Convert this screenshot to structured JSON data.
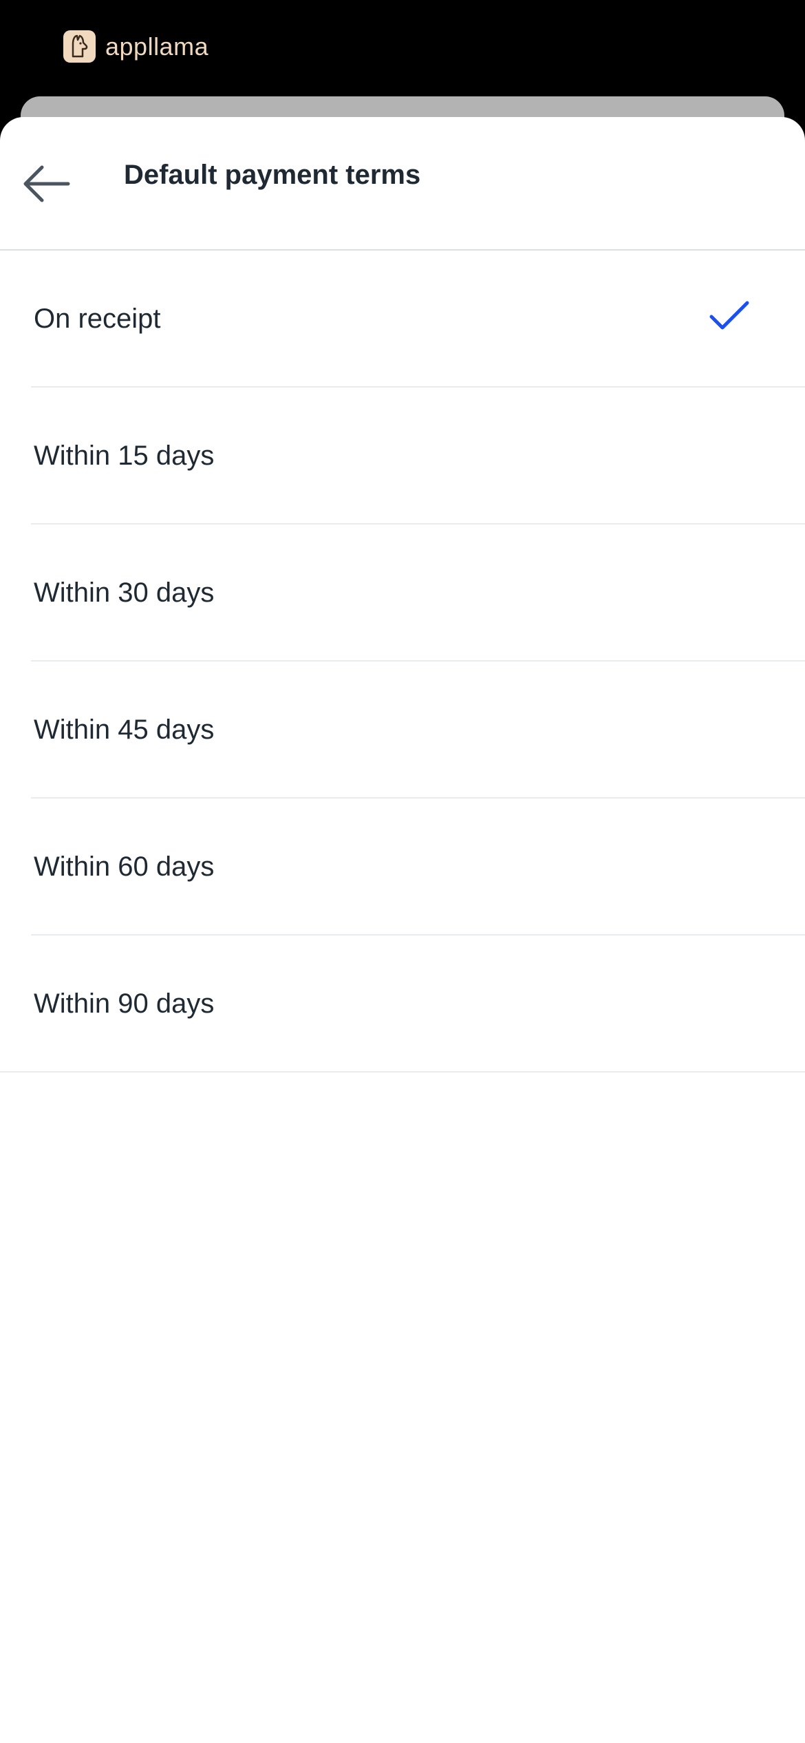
{
  "brand": {
    "name": "appllama",
    "logo_icon": "llama-logo-icon",
    "color": "#f1d9bf"
  },
  "header": {
    "title": "Default payment terms",
    "back_icon": "arrow-left-icon"
  },
  "options": [
    {
      "label": "On receipt",
      "selected": true
    },
    {
      "label": "Within 15 days",
      "selected": false
    },
    {
      "label": "Within 30 days",
      "selected": false
    },
    {
      "label": "Within 45 days",
      "selected": false
    },
    {
      "label": "Within 60 days",
      "selected": false
    },
    {
      "label": "Within 90 days",
      "selected": false
    }
  ],
  "colors": {
    "accent": "#1a4ff0",
    "text": "#1f2933",
    "divider": "#e8ecef"
  }
}
